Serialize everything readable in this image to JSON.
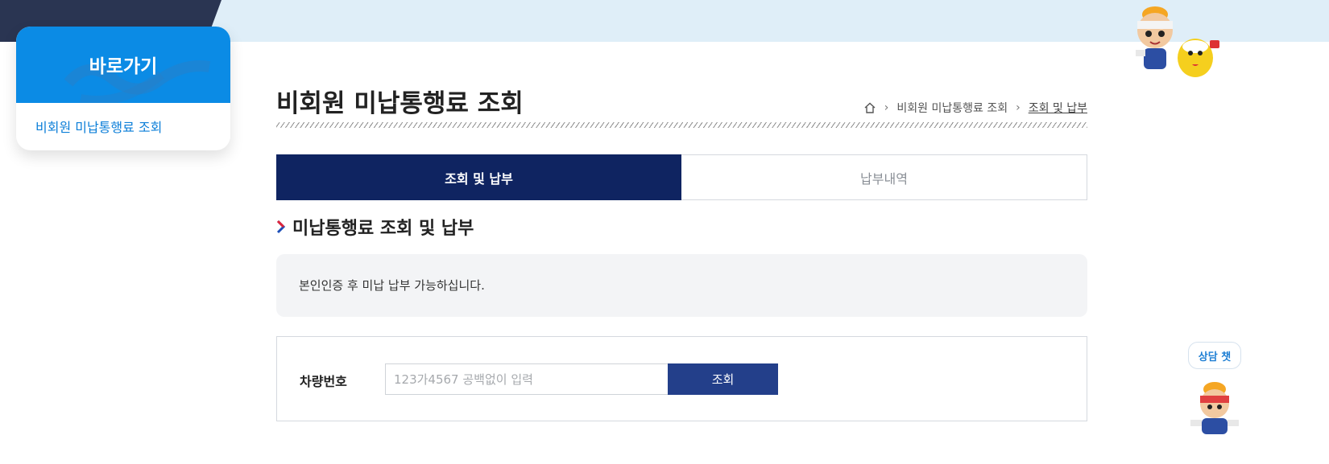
{
  "quick": {
    "title": "바로가기",
    "link": "비회원 미납통행료 조회"
  },
  "page": {
    "title": "비회원 미납통행료 조회"
  },
  "breadcrumb": {
    "level1": "비회원 미납통행료 조회",
    "level2": "조회 및 납부"
  },
  "tabs": [
    {
      "label": "조회 및 납부",
      "active": true
    },
    {
      "label": "납부내역",
      "active": false
    }
  ],
  "section": {
    "title": "미납통행료 조회 및 납부"
  },
  "notice": {
    "text": "본인인증 후 미납 납부 가능하십니다."
  },
  "search": {
    "label": "차량번호",
    "placeholder": "123가4567 공백없이 입력",
    "button": "조회"
  },
  "chat": {
    "label": "상담 챗"
  },
  "colors": {
    "brand_blue": "#0b8be5",
    "navy": "#0f2461",
    "button": "#233f8a"
  }
}
